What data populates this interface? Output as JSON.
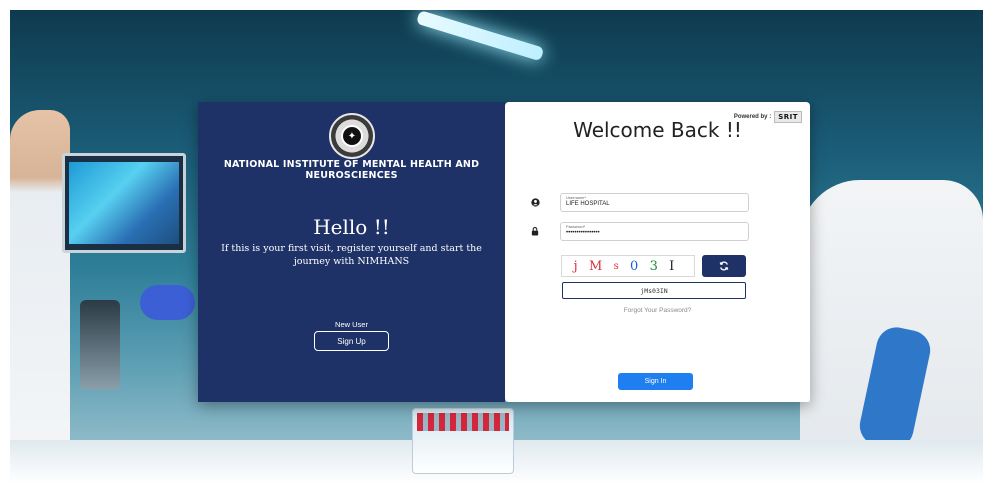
{
  "left_panel": {
    "institute_name": "NATIONAL INSTITUTE OF MENTAL HEALTH AND NEUROSCIENCES",
    "greeting": "Hello !!",
    "message": "If this is your first visit, register yourself and start the journey with NIMHANS",
    "new_user_label": "New User",
    "signup_label": "Sign Up",
    "seal_icon": "institute-seal-logo"
  },
  "right_panel": {
    "powered_by_label": "Powered by :",
    "powered_by_brand": "SRIT",
    "title": "Welcome Back !!",
    "username": {
      "label": "Username*",
      "value": "LIFE HOSPITAL",
      "icon": "user-icon"
    },
    "password": {
      "label": "Password*",
      "value": "••••••••••••••••",
      "icon": "lock-icon"
    },
    "captcha": {
      "characters": [
        "j",
        "M",
        "s",
        "0",
        "3",
        "I"
      ],
      "colors": [
        "#d6333a",
        "#d6333a",
        "#d6333a",
        "#1b5fd6",
        "#1e8b2f",
        "#222222"
      ],
      "input_value": "jMs03IN",
      "refresh_icon": "refresh-icon"
    },
    "forgot_password": "Forgot Your Password?",
    "signin_label": "Sign In"
  },
  "colors": {
    "navy": "#1f3267",
    "signin_blue": "#1f7ef0",
    "card_white": "#ffffff"
  }
}
